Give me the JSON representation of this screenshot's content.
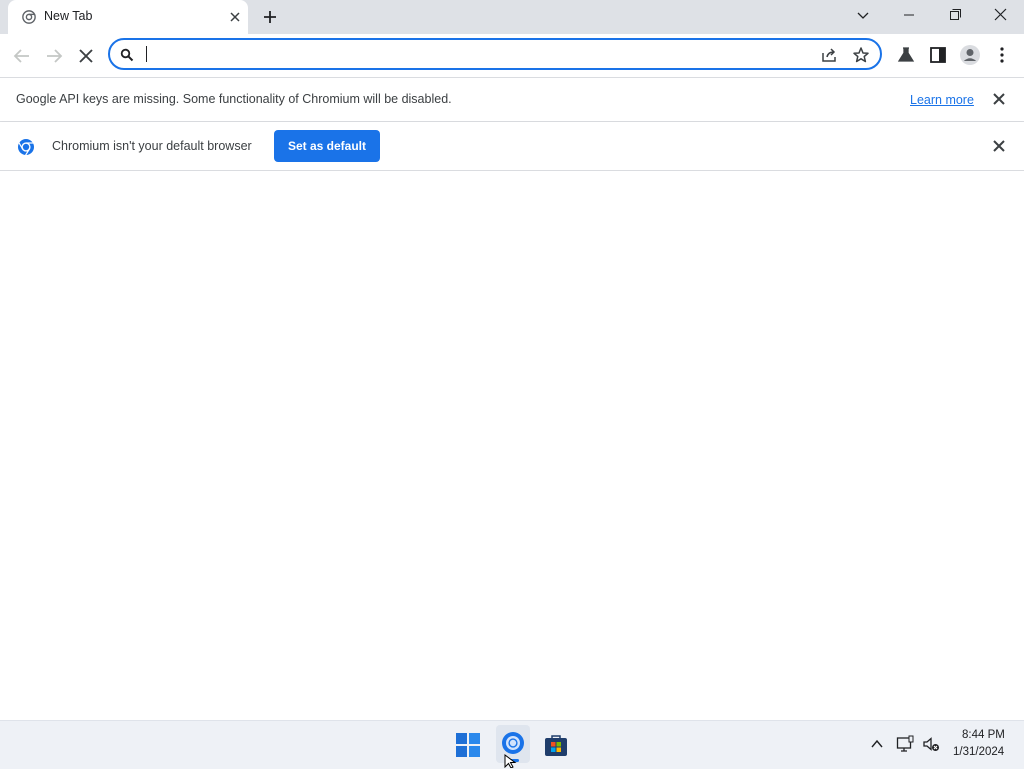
{
  "tab": {
    "title": "New Tab",
    "close_label": "×"
  },
  "omnibox": {
    "value": "",
    "placeholder": ""
  },
  "infobar_api": {
    "text": "Google API keys are missing. Some functionality of Chromium will be disabled.",
    "link": "Learn more"
  },
  "infobar_default": {
    "text": "Chromium isn't your default browser",
    "button": "Set as default"
  },
  "taskbar": {
    "time": "8:44 PM",
    "date": "1/31/2024"
  },
  "colors": {
    "accent": "#1a73e8",
    "tabstrip": "#dee1e6",
    "taskbar": "#eef1f6"
  },
  "icons": [
    "chromium-icon",
    "close-icon",
    "plus-icon",
    "chevron-down-icon",
    "minimize-icon",
    "restore-icon",
    "back-arrow-icon",
    "forward-arrow-icon",
    "stop-icon",
    "search-icon",
    "share-icon",
    "star-icon",
    "flask-icon",
    "side-panel-icon",
    "profile-icon",
    "kebab-menu-icon",
    "windows-start-icon",
    "store-icon",
    "caret-up-icon",
    "network-icon",
    "volume-muted-icon"
  ]
}
